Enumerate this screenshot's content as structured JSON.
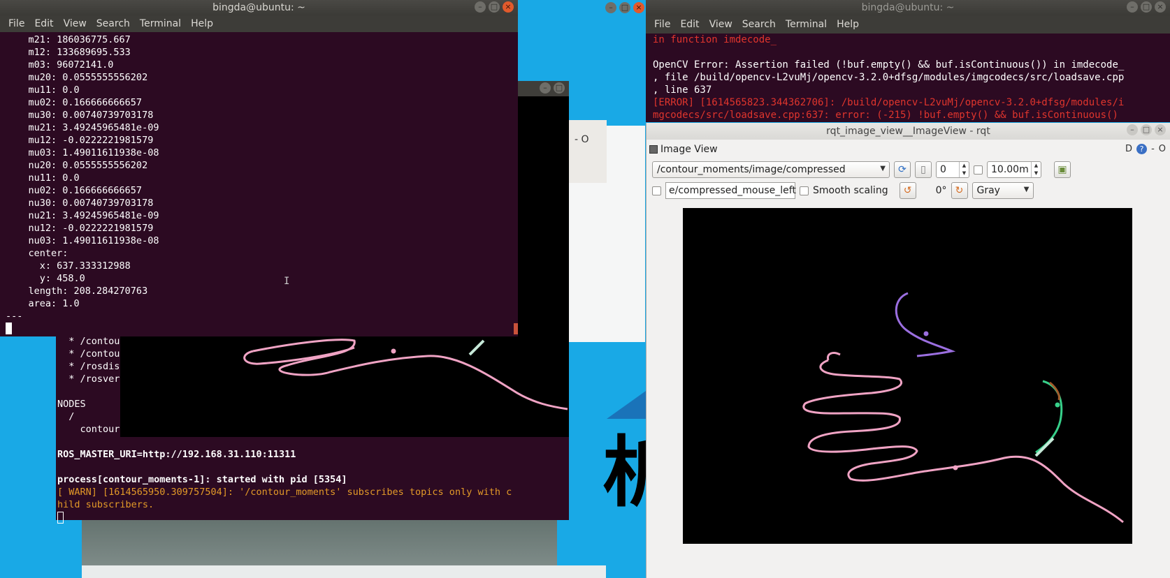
{
  "termA": {
    "title": "bingda@ubuntu: ~",
    "menu": [
      "File",
      "Edit",
      "View",
      "Search",
      "Terminal",
      "Help"
    ],
    "lines": [
      "    m21: 186036775.667",
      "    m12: 133689695.533",
      "    m03: 96072141.0",
      "    mu20: 0.0555555556202",
      "    mu11: 0.0",
      "    mu02: 0.166666666657",
      "    mu30: 0.00740739703178",
      "    mu21: 3.49245965481e-09",
      "    mu12: -0.0222221981579",
      "    mu03: 1.49011611938e-08",
      "    nu20: 0.0555555556202",
      "    nu11: 0.0",
      "    nu02: 0.166666666657",
      "    nu30: 0.00740739703178",
      "    nu21: 3.49245965481e-09",
      "    nu12: -0.0222221981579",
      "    nu03: 1.49011611938e-08",
      "    center:",
      "      x: 637.333312988",
      "      y: 458.0",
      "    length: 208.284270763",
      "    area: 1.0",
      "---"
    ]
  },
  "termB": {
    "lines_top": [
      "  * /contou",
      "  * /contour",
      "  * /rosdist",
      "  * /rosvers",
      "",
      "NODES",
      "  /",
      "    contour"
    ],
    "master_uri": "ROS_MASTER_URI=http://192.168.31.110:11311",
    "process": "process[contour_moments-1]: started with pid [5354]",
    "warn1": "[ WARN] [1614565950.309757504]: '/contour_moments' subscribes topics only with c",
    "warn2": "hild subscribers."
  },
  "termC": {
    "title": "bingda@ubuntu: ~",
    "menu": [
      "File",
      "Edit",
      "View",
      "Search",
      "Terminal",
      "Help"
    ],
    "lines": [
      "in function imdecode_",
      "",
      "OpenCV Error: Assertion failed (!buf.empty() && buf.isContinuous()) in imdecode_",
      ", file /build/opencv-L2vuMj/opencv-3.2.0+dfsg/modules/imgcodecs/src/loadsave.cpp",
      ", line 637"
    ],
    "err1": "[ERROR] [1614565823.344362706]: /build/opencv-L2vuMj/opencv-3.2.0+dfsg/modules/i",
    "err2": "mgcodecs/src/loadsave.cpp:637: error: (-215) !buf.empty() && buf.isContinuous()"
  },
  "rqt": {
    "title": "rqt_image_view__ImageView - rqt",
    "plugin_title": "Image View",
    "plugin_right": [
      "D",
      "?",
      "-",
      "O"
    ],
    "topic": "/contour_moments/image/compressed",
    "spin_value": "0",
    "max_value": "10.00m",
    "mouse_topic": "e/compressed_mouse_left",
    "smooth_label": "Smooth scaling",
    "rotation": "0°",
    "colormap": "Gray"
  },
  "side_labels": [
    "- O",
    "- O"
  ],
  "colors": {
    "terminal_bg": "#2c0a22",
    "warn": "#e39a28",
    "error": "#e0352d",
    "contour_pink": "#f0a3c4",
    "contour_purple": "#9b6fe0",
    "contour_green": "#37d08a",
    "desktop_blue": "#19a9e6"
  }
}
